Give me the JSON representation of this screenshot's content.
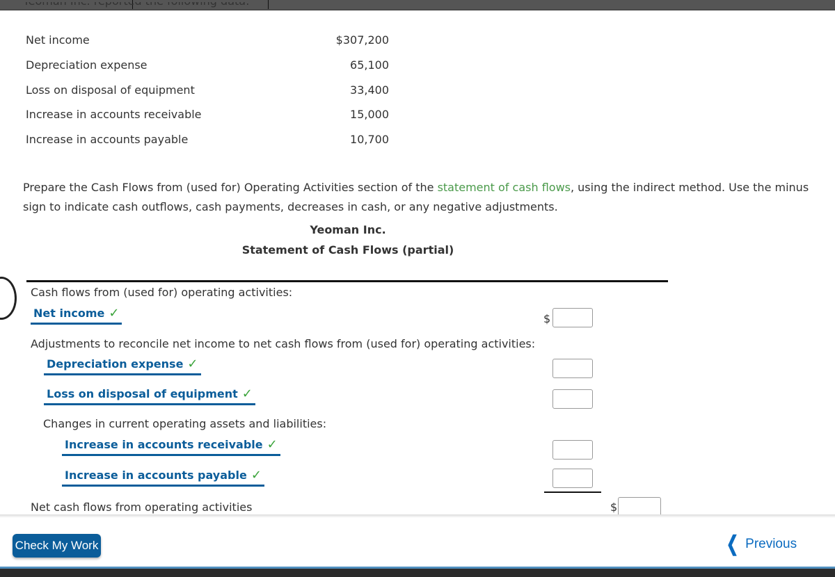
{
  "intro": "Yeoman Inc. reported the following data:",
  "given_data": [
    {
      "label": "Net income",
      "value": "$307,200"
    },
    {
      "label": "Depreciation expense",
      "value": "65,100"
    },
    {
      "label": "Loss on disposal of equipment",
      "value": "33,400"
    },
    {
      "label": "Increase in accounts receivable",
      "value": "15,000"
    },
    {
      "label": "Increase in accounts payable",
      "value": "10,700"
    }
  ],
  "instructions": {
    "before_link": "Prepare the Cash Flows from (used for) Operating Activities section of the ",
    "link": "statement of cash flows",
    "after_link": ", using the indirect method. Use the minus sign to indicate cash outflows, cash payments, decreases in cash, or any negative adjustments."
  },
  "statement": {
    "company": "Yeoman Inc.",
    "title": "Statement of Cash Flows (partial)",
    "section_heading": "Cash flows from (used for) operating activities:",
    "net_income_answer": "Net income",
    "adjustments_heading": "Adjustments to reconcile net income to net cash flows from (used for) operating activities:",
    "depreciation_answer": "Depreciation expense",
    "loss_answer": "Loss on disposal of equipment",
    "changes_heading": "Changes in current operating assets and liabilities:",
    "ar_answer": "Increase in accounts receivable",
    "ap_answer": "Increase in accounts payable",
    "net_cash_label": "Net cash flows from operating activities",
    "dollar_sign": "$",
    "check_mark": "✓",
    "inputs": {
      "net_income": "",
      "depreciation": "",
      "loss": "",
      "ar": "",
      "ap": "",
      "net_cash": ""
    }
  },
  "footer": {
    "check_button": "Check My Work",
    "previous": "Previous"
  },
  "colors": {
    "answer_blue": "#0b5d9a",
    "check_green": "#3aa33a",
    "link_green": "#4a9a4a"
  }
}
